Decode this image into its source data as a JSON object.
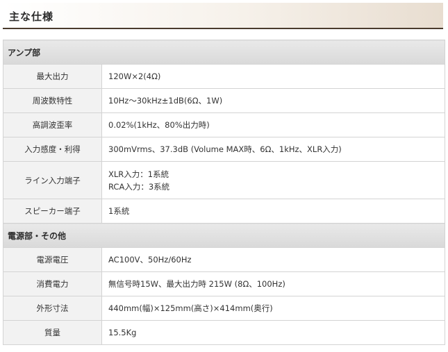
{
  "header": {
    "title": "主な仕様"
  },
  "sections": [
    {
      "title": "アンプ部",
      "rows": [
        {
          "label": "最大出力",
          "value": "120W×2(4Ω)"
        },
        {
          "label": "周波数特性",
          "value": "10Hz～30kHz±1dB(6Ω、1W)"
        },
        {
          "label": "高調波歪率",
          "value": "0.02%(1kHz、80%出力時)"
        },
        {
          "label": "入力感度・利得",
          "value": "300mVrms、37.3dB (Volume MAX時、6Ω、1kHz、XLR入力)"
        },
        {
          "label": "ライン入力端子",
          "lines": [
            "XLR入力：1系統",
            "RCA入力：3系統"
          ]
        },
        {
          "label": "スピーカー端子",
          "value": "1系統"
        }
      ]
    },
    {
      "title": "電源部・その他",
      "rows": [
        {
          "label": "電源電圧",
          "value": "AC100V、50Hz/60Hz"
        },
        {
          "label": "消費電力",
          "value": "無信号時15W、最大出力時 215W (8Ω、100Hz)"
        },
        {
          "label": "外形寸法",
          "value": "440mm(幅)×125mm(高さ)×414mm(奥行)"
        },
        {
          "label": "質量",
          "value": "15.5Kg"
        }
      ]
    }
  ]
}
